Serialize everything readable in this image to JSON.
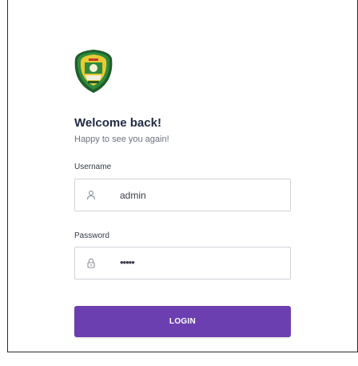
{
  "header": {
    "logo_icon": "regional-government-crest-icon",
    "title": "Welcome back!",
    "subtitle": "Happy to see you again!"
  },
  "form": {
    "username": {
      "label": "Username",
      "value": "admin",
      "icon": "user-icon"
    },
    "password": {
      "label": "Password",
      "value": "•••••",
      "icon": "lock-icon"
    },
    "login_label": "LOGIN"
  },
  "colors": {
    "accent": "#6b3fb0",
    "title": "#1f2a44",
    "muted": "#6b7280",
    "border": "#cfd3d9"
  }
}
